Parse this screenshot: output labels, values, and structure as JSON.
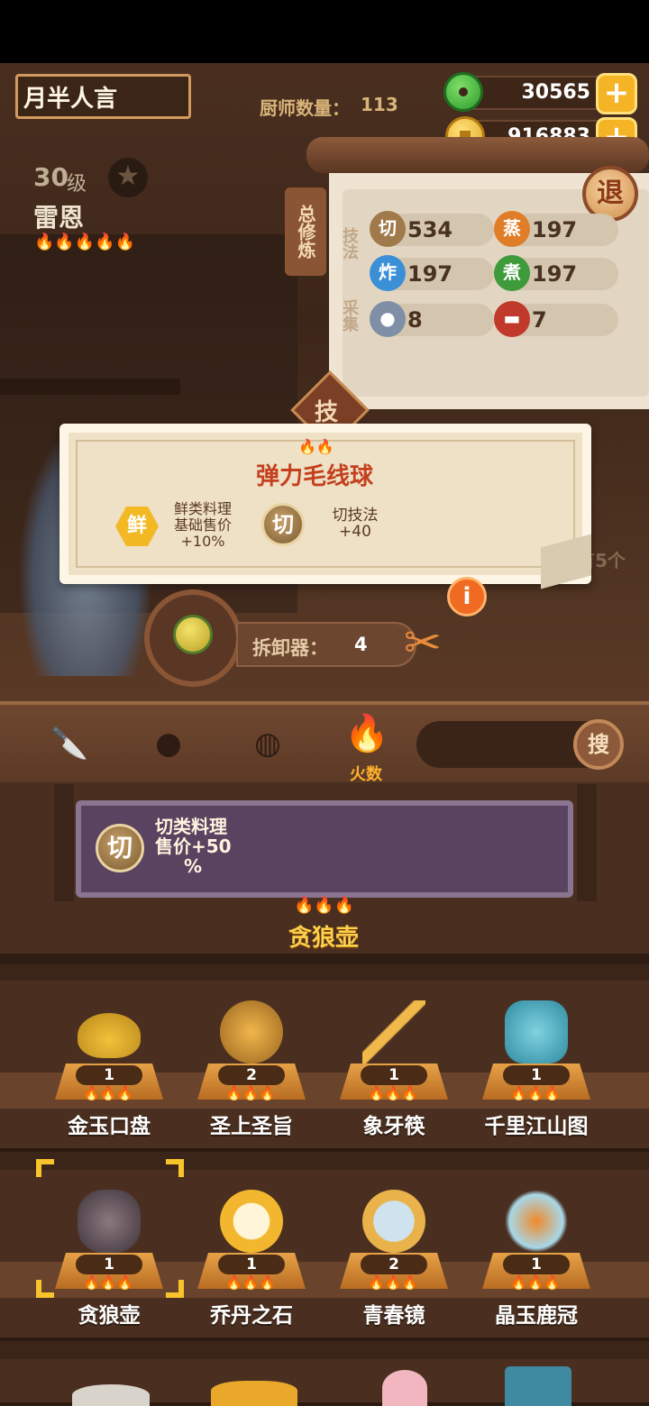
{
  "header": {
    "player_name": "月半人言",
    "chef_count_label": "厨师数量：",
    "chef_count_value": "113",
    "jade_amount": "30565",
    "coin_amount": "916883"
  },
  "chef": {
    "level_num": "30",
    "level_unit": "级",
    "name": "雷恩"
  },
  "panel": {
    "tab_label": "总修炼",
    "skill_label": "技法",
    "gather_label": "采集",
    "exit_label": "退",
    "ji_label": "技",
    "stats": [
      {
        "icon": "切",
        "value": "534",
        "color": "#a07a4a"
      },
      {
        "icon": "蒸",
        "value": "197",
        "color": "#e07d28"
      },
      {
        "icon": "炸",
        "value": "197",
        "color": "#3b8fd6"
      },
      {
        "icon": "煮",
        "value": "197",
        "color": "#3e9a3a"
      },
      {
        "icon": "",
        "value": "8",
        "color": "#7e8fa6"
      },
      {
        "icon": "",
        "value": "7",
        "color": "#c0392b"
      }
    ]
  },
  "tooltip": {
    "title": "弹力毛线球",
    "effect1_icon": "鲜",
    "effect1_text1": "鲜类料理",
    "effect1_text2": "基础售价",
    "effect1_text3": "+10%",
    "effect2_icon": "切",
    "effect2_text1": "切技法",
    "effect2_text2": "+40"
  },
  "bg_hint": "有5个",
  "dismantle": {
    "label": "拆卸器：",
    "value": "4",
    "info_icon": "i"
  },
  "filter": {
    "active_label": "火数",
    "search_label": "搜"
  },
  "detail": {
    "icon": "切",
    "line1": "切类料理",
    "line2": "售价+50",
    "line3": "%",
    "name": "贪狼壶"
  },
  "items": [
    {
      "name": "金玉口盘",
      "count": "1"
    },
    {
      "name": "圣上圣旨",
      "count": "2"
    },
    {
      "name": "象牙筷",
      "count": "1"
    },
    {
      "name": "千里江山图",
      "count": "1"
    },
    {
      "name": "贪狼壶",
      "count": "1"
    },
    {
      "name": "乔丹之石",
      "count": "1"
    },
    {
      "name": "青春镜",
      "count": "2"
    },
    {
      "name": "晶玉鹿冠",
      "count": "1"
    }
  ]
}
